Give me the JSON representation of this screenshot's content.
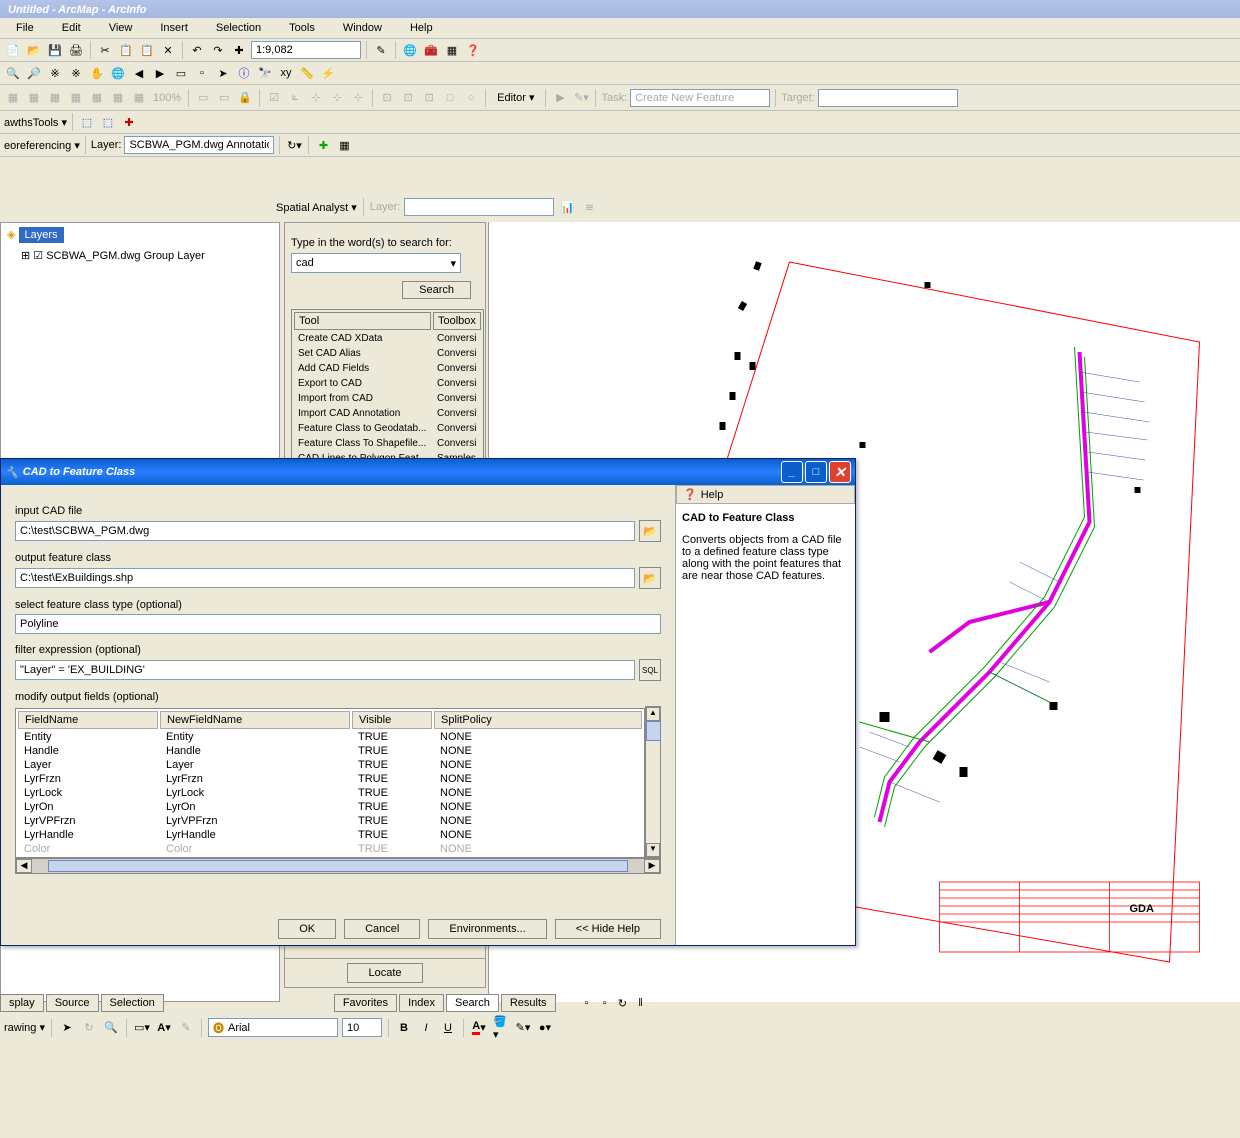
{
  "app": {
    "title": "Untitled - ArcMap - ArcInfo"
  },
  "menu": {
    "items": [
      "File",
      "Edit",
      "View",
      "Insert",
      "Selection",
      "Tools",
      "Window",
      "Help"
    ]
  },
  "toolbar1": {
    "scale": "1:9,082"
  },
  "editor": {
    "label": "Editor",
    "task_label": "Task:",
    "task_value": "Create New Feature",
    "target_label": "Target:"
  },
  "hawths": {
    "label": "awthsTools"
  },
  "georef": {
    "label": "eoreferencing",
    "layer_label": "Layer:",
    "layer_value": "SCBWA_PGM.dwg Annotation"
  },
  "spatial": {
    "label": "Spatial Analyst",
    "layer_label": "Layer:"
  },
  "toc": {
    "root": "Layers",
    "item": "SCBWA_PGM.dwg Group Layer"
  },
  "search": {
    "prompt": "Type in the word(s) to search for:",
    "value": "cad",
    "button": "Search",
    "locate_button": "Locate",
    "cols": [
      "Tool",
      "Toolbox"
    ],
    "rows": [
      [
        "Create CAD XData",
        "Conversi"
      ],
      [
        "Set CAD Alias",
        "Conversi"
      ],
      [
        "Add CAD Fields",
        "Conversi"
      ],
      [
        "Export to CAD",
        "Conversi"
      ],
      [
        "Import from CAD",
        "Conversi"
      ],
      [
        "Import CAD Annotation",
        "Conversi"
      ],
      [
        "Feature Class to Geodatab...",
        "Conversi"
      ],
      [
        "Feature Class To Shapefile...",
        "Conversi"
      ],
      [
        "CAD Lines to Polygon Feat...",
        "Samples"
      ]
    ]
  },
  "dialog": {
    "title": "CAD to Feature Class",
    "input_label": "input CAD file",
    "input_value": "C:\\test\\SCBWA_PGM.dwg",
    "output_label": "output feature class",
    "output_value": "C:\\test\\ExBuildings.shp",
    "fctype_label": "select feature class type (optional)",
    "fctype_value": "Polyline",
    "filter_label": "filter expression (optional)",
    "filter_value": "\"Layer\" = 'EX_BUILDING'",
    "modify_label": "modify output fields (optional)",
    "field_cols": [
      "FieldName",
      "NewFieldName",
      "Visible",
      "SplitPolicy"
    ],
    "field_rows": [
      [
        "Entity",
        "Entity",
        "TRUE",
        "NONE"
      ],
      [
        "Handle",
        "Handle",
        "TRUE",
        "NONE"
      ],
      [
        "Layer",
        "Layer",
        "TRUE",
        "NONE"
      ],
      [
        "LyrFrzn",
        "LyrFrzn",
        "TRUE",
        "NONE"
      ],
      [
        "LyrLock",
        "LyrLock",
        "TRUE",
        "NONE"
      ],
      [
        "LyrOn",
        "LyrOn",
        "TRUE",
        "NONE"
      ],
      [
        "LyrVPFrzn",
        "LyrVPFrzn",
        "TRUE",
        "NONE"
      ],
      [
        "LyrHandle",
        "LyrHandle",
        "TRUE",
        "NONE"
      ],
      [
        "Color",
        "Color",
        "TRUE",
        "NONE"
      ]
    ],
    "buttons": {
      "ok": "OK",
      "cancel": "Cancel",
      "env": "Environments...",
      "hide": "<< Hide Help"
    },
    "help": {
      "hdr": "Help",
      "title": "CAD to Feature Class",
      "body": "Converts objects from a CAD file to a defined feature class type along with the point features that are near those CAD features."
    }
  },
  "tabs_left": [
    "splay",
    "Source",
    "Selection"
  ],
  "tabs_right": [
    "Favorites",
    "Index",
    "Search",
    "Results"
  ],
  "drawing": {
    "label": "rawing",
    "font": "Arial",
    "size": "10"
  }
}
